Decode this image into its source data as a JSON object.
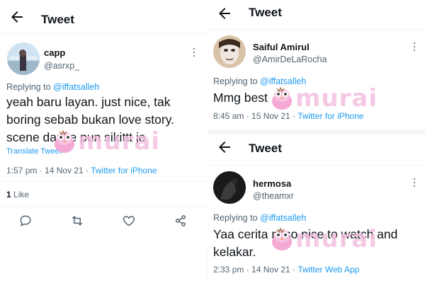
{
  "left": {
    "header": {
      "title": "Tweet"
    },
    "author": {
      "name": "capp",
      "handle": "@asrxp_"
    },
    "replying": {
      "prefix": "Replying to",
      "mention": "@iffatsalleh"
    },
    "text_lines": [
      "yeah baru layan. just nice, tak",
      "boring sebab bukan love story.",
      "scene dance pun sikittt je"
    ],
    "translate_label": "Translate Tweet",
    "meta": {
      "time": "1:57 pm · 14 Nov 21 · ",
      "source": "Twitter for iPhone"
    },
    "likes": {
      "count": "1",
      "label": "Like"
    },
    "actions": {
      "reply": "reply-icon",
      "retweet": "retweet-icon",
      "like": "heart-icon",
      "share": "share-icon"
    }
  },
  "right_top": {
    "header": {
      "title": "Tweet"
    },
    "author": {
      "name": "Saiful Amirul",
      "handle": "@AmirDeLaRocha"
    },
    "replying": {
      "prefix": "Replying to",
      "mention": "@iffatsalleh"
    },
    "text_lines": [
      "Mmg best"
    ],
    "meta": {
      "time": "8:45 am · 15 Nov 21 · ",
      "source": "Twitter for iPhone"
    }
  },
  "right_bottom": {
    "header": {
      "title": "Tweet"
    },
    "author": {
      "name": "hermosa",
      "handle": "@theamxr"
    },
    "replying": {
      "prefix": "Replying to",
      "mention": "@iffatsalleh"
    },
    "text_lines": [
      "Yaa cerita ni so nice to watch and",
      "kelakar."
    ],
    "meta": {
      "time": "2:33 pm · 14 Nov 21 · ",
      "source": "Twitter Web App"
    }
  },
  "watermark": {
    "text": "murai"
  },
  "colors": {
    "accent": "#1d9bf0",
    "muted": "#536471",
    "text": "#0f1419",
    "watermark": "#f4c0e0"
  }
}
